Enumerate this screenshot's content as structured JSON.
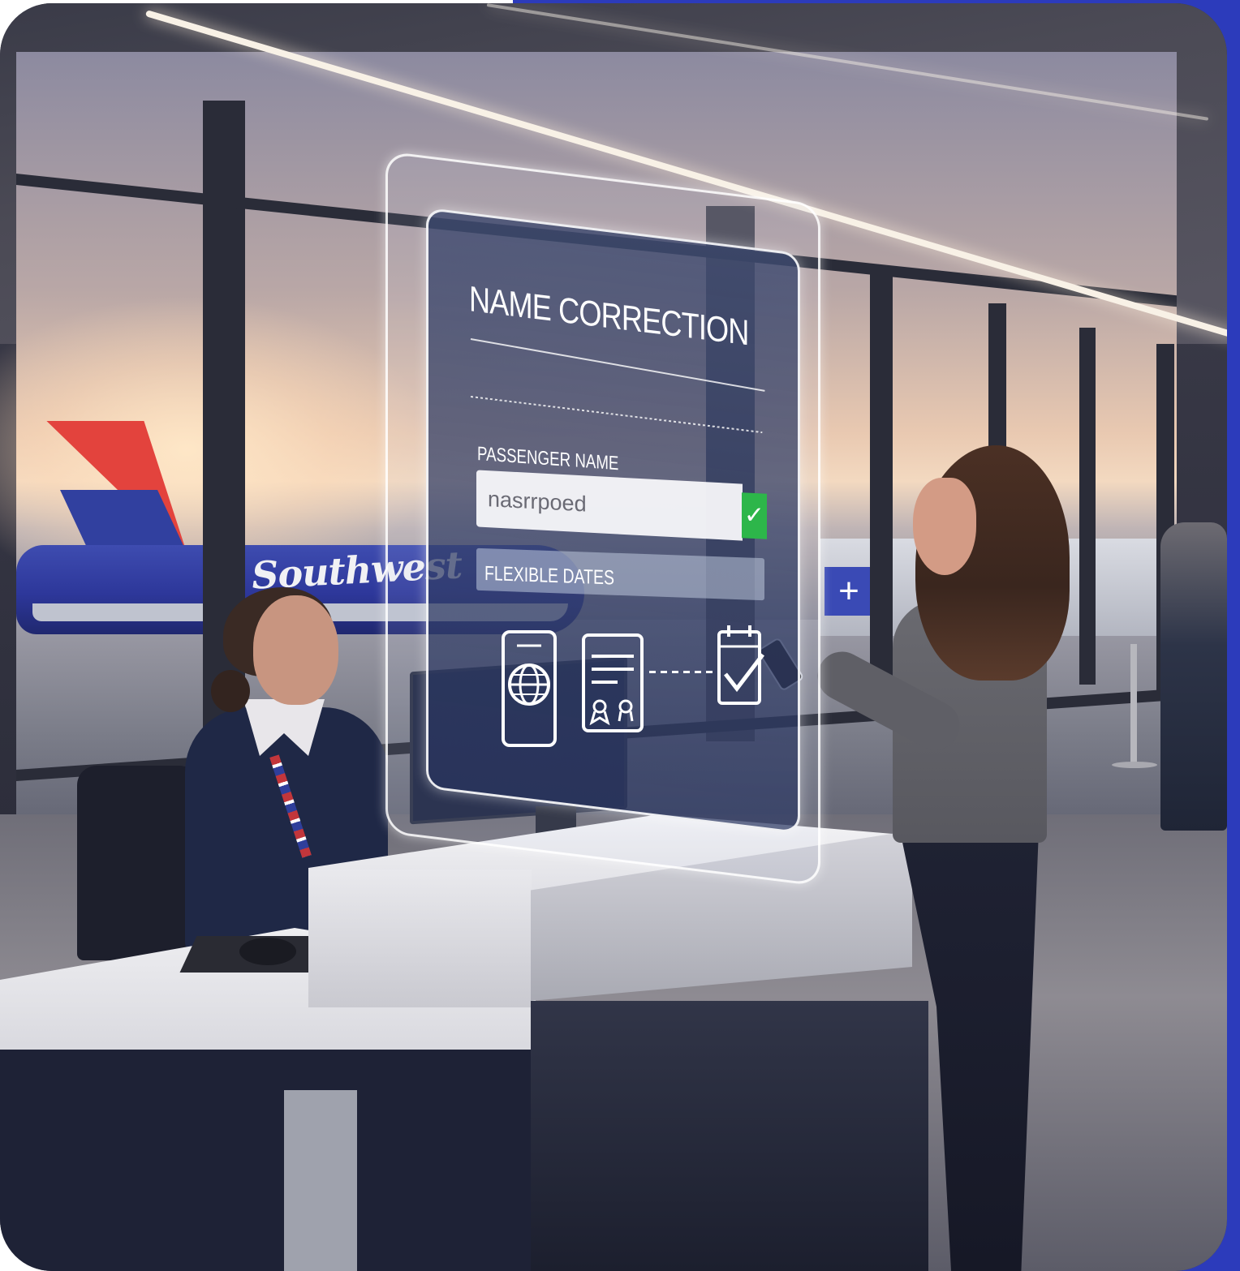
{
  "scene": {
    "brand_frame_color": "#2c3bbb",
    "aircraft_livery_text": "Southwest"
  },
  "hologram": {
    "title": "NAME CORRECTION",
    "passenger_name_label": "PASSENGER NAME",
    "passenger_name_value": "nasrrpoed",
    "name_valid": true,
    "flexible_dates_label": "FLEXIBLE DATES",
    "icons": [
      "passport-globe-icon",
      "certificate-document-icon",
      "calendar-check-icon"
    ]
  },
  "colors": {
    "check_green": "#2db64a",
    "panel_tint": "#3c486e"
  }
}
